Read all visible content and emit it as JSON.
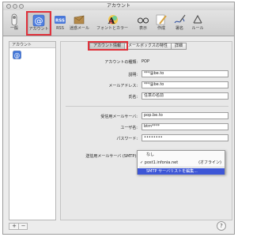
{
  "window": {
    "title": "アカウント"
  },
  "toolbar": {
    "items": [
      {
        "label": "一般",
        "icon": "general-switch-icon"
      },
      {
        "label": "アカウント",
        "icon": "at-sign-icon"
      },
      {
        "label": "RSS",
        "icon": "rss-icon"
      },
      {
        "label": "迷惑メール",
        "icon": "junk-mail-icon"
      },
      {
        "label": "フォントとカラー",
        "icon": "fonts-colors-icon"
      },
      {
        "label": "表示",
        "icon": "viewing-glasses-icon"
      },
      {
        "label": "作成",
        "icon": "composing-pencil-icon"
      },
      {
        "label": "署名",
        "icon": "signature-pen-icon"
      },
      {
        "label": "ルール",
        "icon": "rules-icon"
      }
    ],
    "highlight_color": "#e0323c"
  },
  "sidebar": {
    "header": "アカウント",
    "add_symbol": "+",
    "remove_symbol": "−"
  },
  "tabs": [
    {
      "label": "アカウント情報",
      "active": true
    },
    {
      "label": "メールボックスの特性",
      "active": false
    },
    {
      "label": "詳細",
      "active": false
    }
  ],
  "form": {
    "account_type_label": "アカウントの種類:",
    "account_type_value": "POP",
    "description_label": "説明:",
    "description_value": "***@be.to",
    "email_label": "メールアドレス:",
    "email_value": "***@be.to",
    "fullname_label": "氏名:",
    "fullname_value": "任意の名前",
    "incoming_server_label": "受信用メールサーバ:",
    "incoming_server_value": "pop.be.to",
    "username_label": "ユーザ名:",
    "username_value": "btm****",
    "password_label": "パスワード:",
    "password_value": "••••••••",
    "smtp_label": "送信用メールサーバ (SMTP):"
  },
  "smtp_popup": {
    "items": [
      {
        "label": "なし",
        "checked": false
      },
      {
        "label": "post1.infonia.net",
        "status": "(オフライン)",
        "checked": true
      },
      {
        "label": "SMTP サーバリストを編集...",
        "highlighted": true
      }
    ],
    "checkmark": "✓"
  },
  "help": {
    "symbol": "?"
  }
}
